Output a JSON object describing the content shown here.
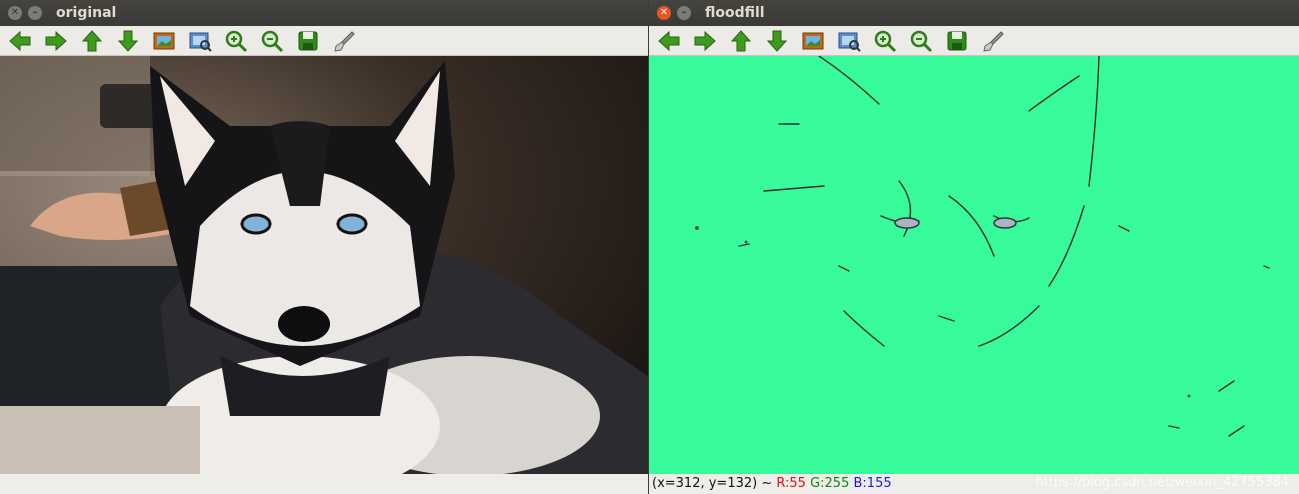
{
  "colors": {
    "fill": "#37fb9b",
    "close_active": "#e95420"
  },
  "left_window": {
    "title": "original",
    "toolbar": [
      "arrow-left-icon",
      "arrow-right-icon",
      "arrow-up-icon",
      "arrow-down-icon",
      "image-icon",
      "zoom-fit-icon",
      "zoom-in-icon",
      "zoom-out-icon",
      "save-icon",
      "brush-icon"
    ]
  },
  "right_window": {
    "title": "floodfill",
    "toolbar": [
      "arrow-left-icon",
      "arrow-right-icon",
      "arrow-up-icon",
      "arrow-down-icon",
      "image-icon",
      "zoom-fit-icon",
      "zoom-in-icon",
      "zoom-out-icon",
      "save-icon",
      "brush-icon"
    ],
    "status": {
      "coords": "(x=312, y=132) ~",
      "r": "R:55",
      "g": "G:255",
      "b": "B:155"
    },
    "watermark": "https://blog.csdn.net/weixin_42755384"
  }
}
